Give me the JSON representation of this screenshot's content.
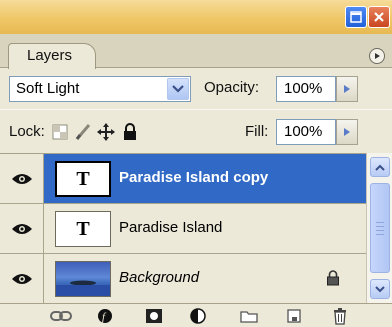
{
  "panel": {
    "tab_label": "Layers",
    "blend_mode": "Soft Light",
    "opacity_label": "Opacity:",
    "opacity_value": "100%",
    "lock_label": "Lock:",
    "fill_label": "Fill:",
    "fill_value": "100%"
  },
  "layers": [
    {
      "name": "Paradise Island copy",
      "thumb_glyph": "T",
      "selected": true
    },
    {
      "name": "Paradise Island",
      "thumb_glyph": "T",
      "selected": false
    },
    {
      "name": "Background",
      "thumb_glyph": "",
      "selected": false,
      "locked": true
    }
  ],
  "colors": {
    "selection": "#3169c6",
    "titlebar": "#efc866",
    "panel_bg": "#ece9d8"
  }
}
